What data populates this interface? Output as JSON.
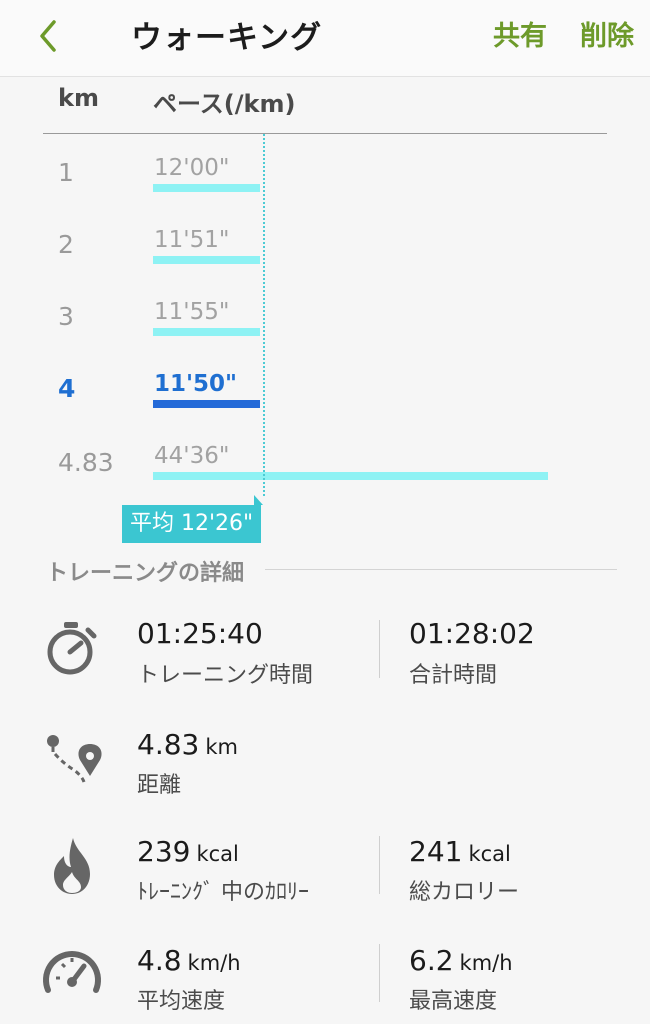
{
  "header": {
    "title": "ウォーキング",
    "share_label": "共有",
    "delete_label": "削除"
  },
  "pace_table": {
    "col_km": "km",
    "col_pace": "ペース(/km)",
    "splits": [
      {
        "km": "1",
        "pace": "12'00\"",
        "active": false,
        "bar_fraction": 0.27
      },
      {
        "km": "2",
        "pace": "11'51\"",
        "active": false,
        "bar_fraction": 0.27
      },
      {
        "km": "3",
        "pace": "11'55\"",
        "active": false,
        "bar_fraction": 0.27
      },
      {
        "km": "4",
        "pace": "11'50\"",
        "active": true,
        "bar_fraction": 0.27
      },
      {
        "km": "4.83",
        "pace": "44'36\"",
        "active": false,
        "bar_fraction": 1.0
      }
    ],
    "average_label": "平均 12'26\""
  },
  "details": {
    "section_title": "トレーニングの詳細",
    "rows": [
      {
        "icon": "stopwatch-icon",
        "left": {
          "value": "01:25:40",
          "unit": "",
          "label": "トレーニング時間"
        },
        "right": {
          "value": "01:28:02",
          "unit": "",
          "label": "合計時間"
        }
      },
      {
        "icon": "route-icon",
        "left": {
          "value": "4.83",
          "unit": "km",
          "label": "距離"
        }
      },
      {
        "icon": "flame-icon",
        "left": {
          "value": "239",
          "unit": "kcal",
          "label": "ﾄﾚｰﾆﾝｸﾞ 中のｶﾛﾘｰ"
        },
        "right": {
          "value": "241",
          "unit": "kcal",
          "label": "総カロリー"
        }
      },
      {
        "icon": "speedometer-icon",
        "left": {
          "value": "4.8",
          "unit": "km/h",
          "label": "平均速度"
        },
        "right": {
          "value": "6.2",
          "unit": "km/h",
          "label": "最高速度"
        }
      }
    ]
  },
  "colors": {
    "accent_green": "#6d9a2a",
    "bar": "#8ef2f4",
    "bar_active": "#246ad8",
    "avg_tag": "#3bc6d1"
  }
}
